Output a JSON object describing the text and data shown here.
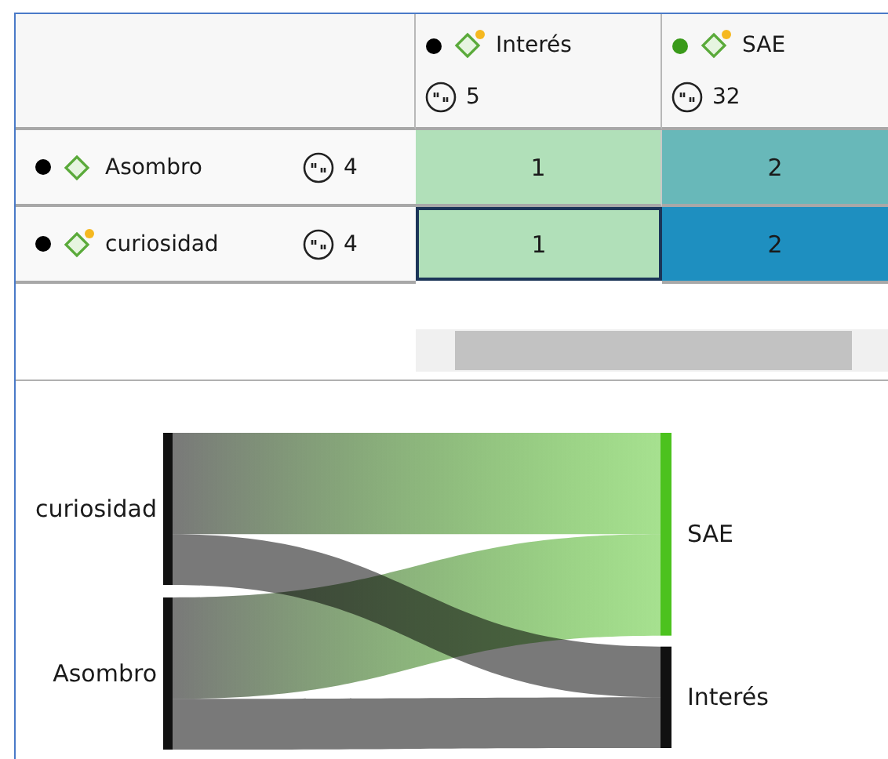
{
  "columns": [
    {
      "label": "Interés",
      "color": "#000000",
      "has_memo": true,
      "count": "5"
    },
    {
      "label": "SAE",
      "color": "#3a9a1a",
      "has_memo": true,
      "count": "32"
    }
  ],
  "rows": [
    {
      "label": "Asombro",
      "color": "#000000",
      "has_memo": false,
      "count": "4",
      "cells": [
        {
          "value": "1",
          "color": "#b1e0b9",
          "selected": false
        },
        {
          "value": "2",
          "color": "#68b8b9",
          "selected": false
        }
      ]
    },
    {
      "label": "curiosidad",
      "color": "#000000",
      "has_memo": true,
      "count": "4",
      "cells": [
        {
          "value": "1",
          "color": "#b1e0b9",
          "selected": true
        },
        {
          "value": "2",
          "color": "#1e8fc0",
          "selected": false
        }
      ]
    }
  ],
  "sankey": {
    "sources": [
      {
        "label": "curiosidad"
      },
      {
        "label": "Asombro"
      }
    ],
    "targets": [
      {
        "label": "SAE",
        "color": "#4cc21e"
      },
      {
        "label": "Interés",
        "color": "#111111"
      }
    ]
  }
}
